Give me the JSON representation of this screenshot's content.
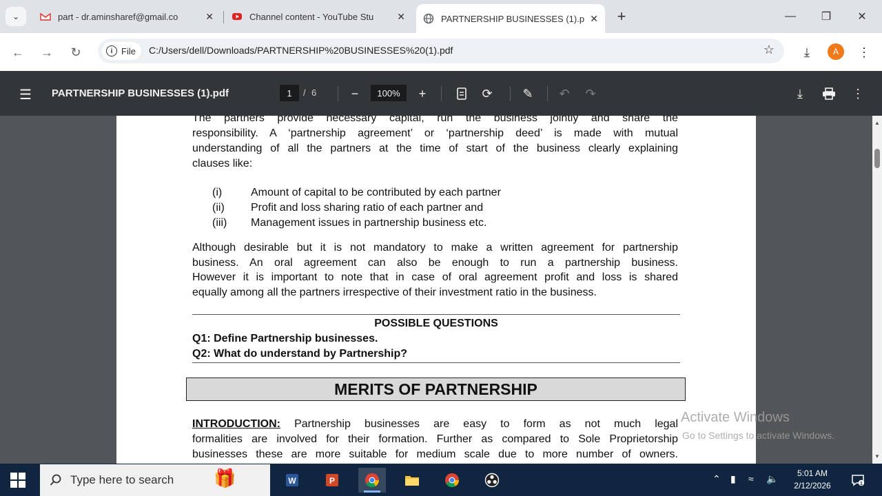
{
  "browser": {
    "tabs": [
      {
        "title": "part - dr.aminsharef@gmail.co",
        "icon": "gmail-icon"
      },
      {
        "title": "Channel content - YouTube Stu",
        "icon": "youtube-icon"
      },
      {
        "title": "PARTNERSHIP BUSINESSES (1).p",
        "icon": "globe-icon",
        "active": true
      }
    ],
    "new_tab": "+",
    "address": {
      "chip": "File",
      "url": "C:/Users/dell/Downloads/PARTNERSHIP%20BUSINESSES%20(1).pdf"
    },
    "profile_initial": "A"
  },
  "pdf_toolbar": {
    "filename": "PARTNERSHIP BUSINESSES (1).pdf",
    "current_page": "1",
    "page_separator": "/",
    "total_pages": "6",
    "zoom": "100%"
  },
  "document": {
    "partial_top_line": "The partners provide necessary capital, run the business jointly and share the",
    "intro_lines": [
      "responsibility. A ‘partnership agreement’ or ‘partnership deed’ is made with mutual",
      "understanding of all the partners at the time of start of the business clearly explaining",
      "clauses like:"
    ],
    "clauses": [
      {
        "num": "(i)",
        "text": "Amount of capital to be contributed by each partner"
      },
      {
        "num": "(ii)",
        "text": "Profit and loss sharing ratio of each partner and"
      },
      {
        "num": "(iii)",
        "text": "Management issues in partnership business etc."
      }
    ],
    "para2_lines": [
      "Although desirable but it is not mandatory to make a written agreement for partnership",
      "business. An oral agreement can also be enough to run a partnership business.",
      "However it is important to note that in case of oral agreement profit and loss is shared",
      "equally among all the partners irrespective of their investment ratio in the business."
    ],
    "questions_heading": "POSSIBLE QUESTIONS",
    "questions": [
      "Q1: Define Partnership businesses.",
      "Q2:  What do understand by Partnership?"
    ],
    "section_heading": "MERITS OF PARTNERSHIP",
    "intro_label": "INTRODUCTION:",
    "intro_first_line": " Partnership businesses are easy to form as not much legal",
    "intro_rest": [
      "formalities are involved for their formation. Further as compared to Sole Proprietorship",
      "businesses these are more suitable for medium scale due to more number of owners."
    ]
  },
  "watermark": {
    "line1": "Activate Windows",
    "line2": "Go to Settings to activate Windows."
  },
  "taskbar": {
    "search_placeholder": "Type here to search",
    "time": "5:01 AM",
    "date": "2/12/2026",
    "notification_count": "1"
  },
  "colors": {
    "tab_strip": "#dfe3e7",
    "pdf_toolbar": "#323639",
    "viewer_bg": "#525659",
    "taskbar": "#0f2540",
    "profile": "#f07a1a"
  }
}
